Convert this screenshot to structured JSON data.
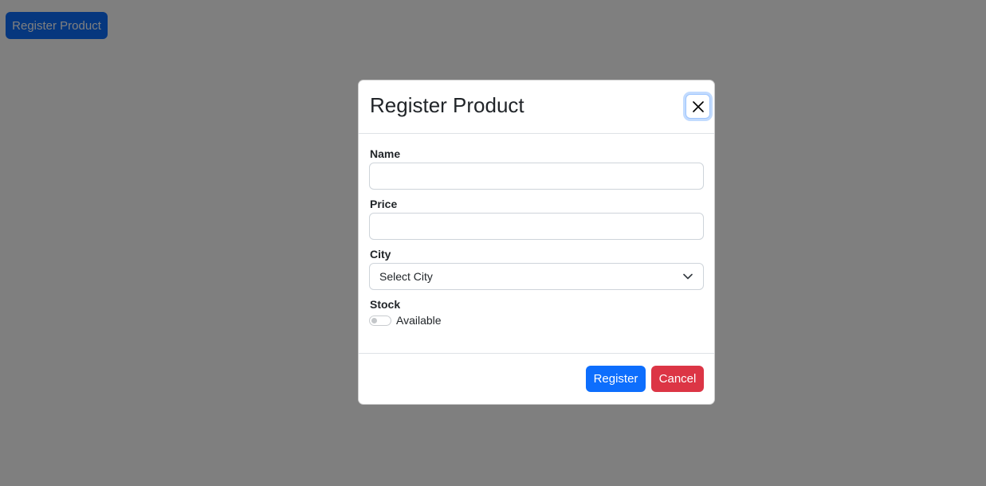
{
  "page": {
    "open_button_label": "Register Product"
  },
  "modal": {
    "title": "Register Product",
    "close_icon": "close-icon",
    "fields": {
      "name": {
        "label": "Name",
        "value": "",
        "placeholder": ""
      },
      "price": {
        "label": "Price",
        "value": "",
        "placeholder": ""
      },
      "city": {
        "label": "City",
        "selected": "Select City"
      },
      "stock": {
        "label": "Stock",
        "switch_label": "Available",
        "checked": false
      }
    },
    "footer": {
      "register_label": "Register",
      "cancel_label": "Cancel"
    }
  },
  "colors": {
    "primary": "#0d6efd",
    "danger": "#dc3545",
    "backdrop": "rgba(0,0,0,0.5)"
  }
}
